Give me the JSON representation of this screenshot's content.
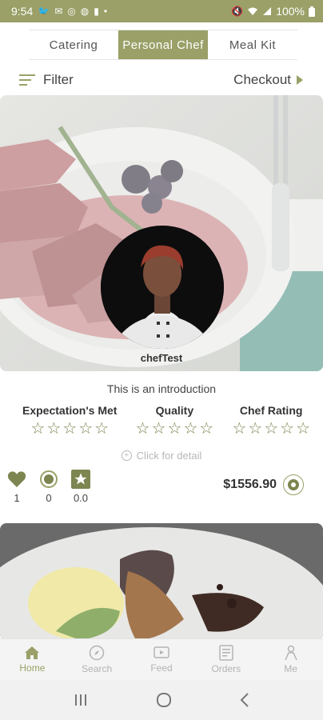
{
  "status_bar": {
    "time": "9:54",
    "battery": "100%"
  },
  "tabs": [
    {
      "label": "Catering"
    },
    {
      "label": "Personal Chef"
    },
    {
      "label": "Meal Kit"
    }
  ],
  "filter_label": "Filter",
  "checkout_label": "Checkout",
  "card": {
    "chef_name": "chefTest",
    "intro": "This is an introduction",
    "ratings": [
      {
        "label": "Expectation's Met",
        "stars": 0
      },
      {
        "label": "Quality",
        "stars": 0
      },
      {
        "label": "Chef Rating",
        "stars": 0
      }
    ],
    "detail_label": "Click for detail",
    "likes": "1",
    "coins_count": "0",
    "rating_value": "0.0",
    "price": "$1556.90"
  },
  "bottom_nav": [
    {
      "label": "Home",
      "icon": "home-icon"
    },
    {
      "label": "Search",
      "icon": "compass-icon"
    },
    {
      "label": "Feed",
      "icon": "video-icon"
    },
    {
      "label": "Orders",
      "icon": "document-icon"
    },
    {
      "label": "Me",
      "icon": "person-icon"
    }
  ],
  "colors": {
    "accent": "#9aa067",
    "star": "#7d8550"
  }
}
